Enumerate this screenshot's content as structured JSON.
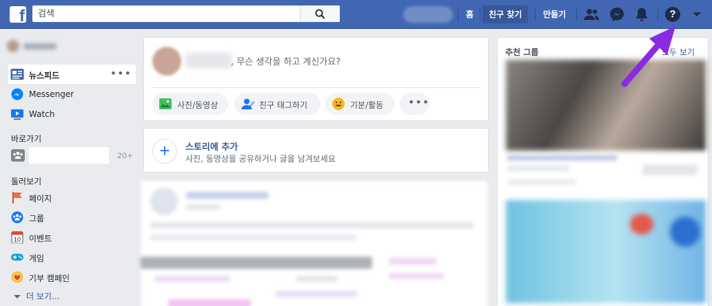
{
  "topbar": {
    "search_placeholder": "검색",
    "nav_home": "홈",
    "nav_find_friends": "친구 찾기",
    "nav_create": "만들기",
    "help_glyph": "?",
    "colors": {
      "bar": "#4267b2",
      "active": "#365899"
    }
  },
  "sidebar": {
    "items": [
      {
        "label": "뉴스피드",
        "icon": "news-feed-icon"
      },
      {
        "label": "Messenger",
        "icon": "messenger-icon"
      },
      {
        "label": "Watch",
        "icon": "watch-icon"
      }
    ],
    "more_dots": "•••",
    "shortcuts_title": "바로가기",
    "shortcut_count": "20+",
    "explore_title": "둘러보기",
    "explore": [
      {
        "label": "페이지",
        "icon": "flag-icon"
      },
      {
        "label": "그룹",
        "icon": "groups-icon"
      },
      {
        "label": "이벤트",
        "icon": "calendar-icon"
      },
      {
        "label": "게임",
        "icon": "gamepad-icon"
      },
      {
        "label": "기부 캠페인",
        "icon": "heart-coin-icon"
      }
    ],
    "see_more": "더 보기..."
  },
  "composer": {
    "prompt": ", 무슨 생각을 하고 계신가요?",
    "actions": [
      "사진/동영상",
      "친구 태그하기",
      "기분/활동"
    ],
    "more_dots": "•••"
  },
  "story": {
    "plus": "+",
    "title": "스토리에 추가",
    "subtitle": "사진, 동영상을 공유하거나 글을 남겨보세요"
  },
  "right": {
    "title": "추천 그룹",
    "see_all": "모두 보기"
  },
  "annotation": {
    "arrow_color": "#8a2be2"
  }
}
